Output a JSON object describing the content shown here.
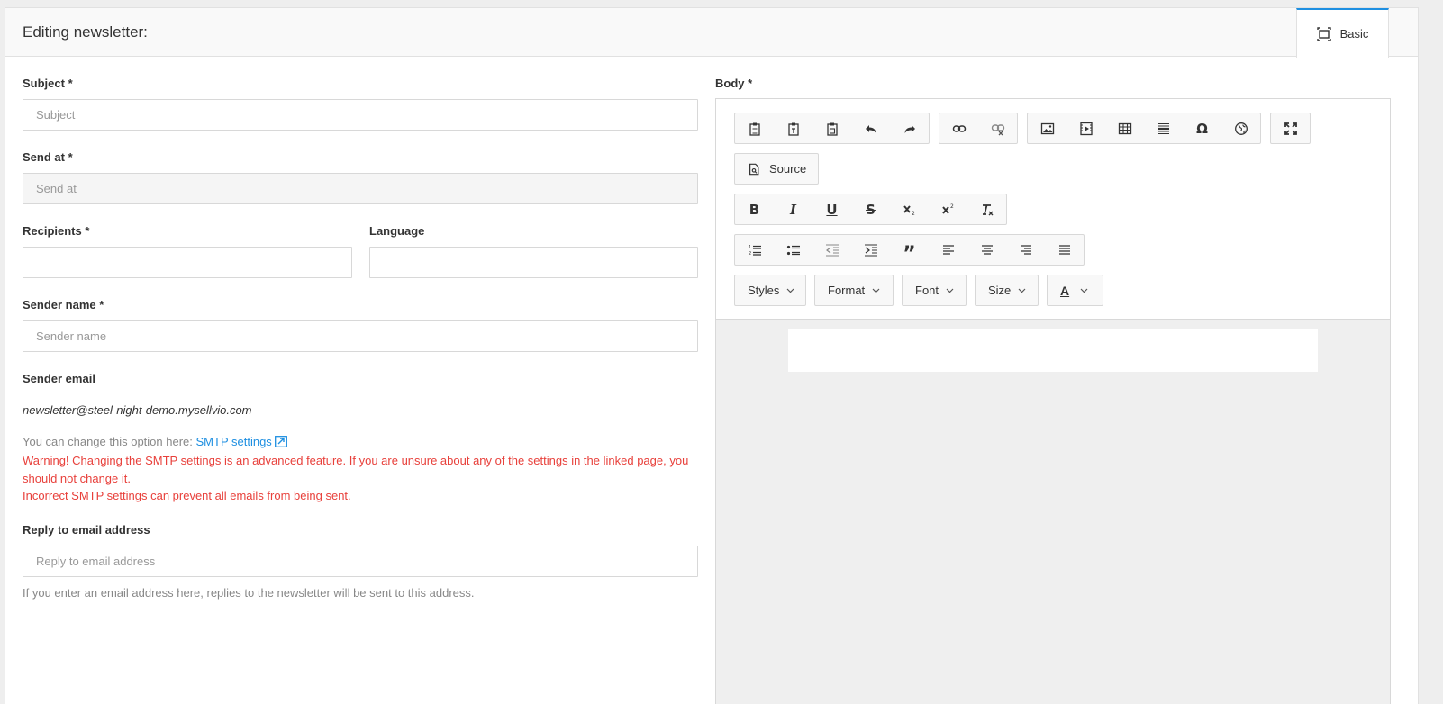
{
  "header": {
    "title": "Editing newsletter:",
    "mode_tab": "Basic"
  },
  "form": {
    "subject": {
      "label": "Subject *",
      "placeholder": "Subject",
      "value": ""
    },
    "send_at": {
      "label": "Send at *",
      "placeholder": "Send at",
      "value": ""
    },
    "recipients": {
      "label": "Recipients *",
      "value": ""
    },
    "language": {
      "label": "Language",
      "value": ""
    },
    "sender_name": {
      "label": "Sender name *",
      "placeholder": "Sender name",
      "value": ""
    },
    "sender_email": {
      "label": "Sender email",
      "value": "newsletter@steel-night-demo.mysellvio.com"
    },
    "smtp_hint": {
      "prefix": "You can change this option here:",
      "link": "SMTP settings"
    },
    "warning_1": "Warning! Changing the SMTP settings is an advanced feature. If you are unsure about any of the settings in the linked page, you should not change it.",
    "warning_2": "Incorrect SMTP settings can prevent all emails from being sent.",
    "reply_to": {
      "label": "Reply to email address",
      "placeholder": "Reply to email address",
      "value": ""
    },
    "reply_help": "If you enter an email address here, replies to the newsletter will be sent to this address."
  },
  "editor": {
    "label": "Body *",
    "source_label": "Source",
    "combos": {
      "styles": "Styles",
      "format": "Format",
      "font": "Font",
      "size": "Size"
    },
    "text_color_glyph": "A"
  },
  "colors": {
    "accent": "#1e8fe1",
    "warning": "#e8403b"
  }
}
